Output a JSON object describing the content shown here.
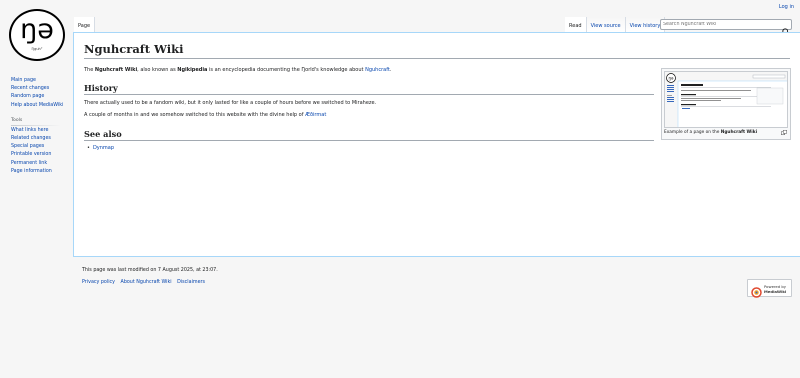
{
  "logo": {
    "glyph": "ŋə",
    "subtitle": "Ŋguh°"
  },
  "personal": {
    "login": "Log in"
  },
  "sidebar": {
    "navigation": [
      {
        "label": "Main page"
      },
      {
        "label": "Recent changes"
      },
      {
        "label": "Random page"
      },
      {
        "label": "Help about MediaWiki"
      }
    ],
    "tools_heading": "Tools",
    "tools": [
      {
        "label": "What links here"
      },
      {
        "label": "Related changes"
      },
      {
        "label": "Special pages"
      },
      {
        "label": "Printable version"
      },
      {
        "label": "Permanent link"
      },
      {
        "label": "Page information"
      }
    ]
  },
  "tabs": {
    "left": [
      {
        "label": "Page"
      }
    ],
    "right": [
      {
        "label": "Read"
      },
      {
        "label": "View source"
      },
      {
        "label": "View history"
      }
    ]
  },
  "search": {
    "placeholder": "Search Nguhcraft Wiki"
  },
  "article": {
    "title": "Nguhcraft Wiki",
    "intro": {
      "t1": "The ",
      "b1": "Nguhcraft Wiki",
      "t2": ", also known as ",
      "b2": "Ngikipedia",
      "t3": " is an encyclopedia documenting the Ŋorld's knowledge about ",
      "link": "Nguhcraft",
      "t4": "."
    },
    "history_heading": "History",
    "history_p1": "There actually used to be a fandom wiki, but it only lasted for like a couple of hours before we switched to Miraheze.",
    "history_p2": {
      "text": "A couple of months in and we somehow switched to this website with the divine help of ",
      "link": "Æðirmat"
    },
    "seealso_heading": "See also",
    "seealso": [
      {
        "label": "Dynmap"
      }
    ]
  },
  "thumbnail": {
    "caption_prefix": "Example of a page on the ",
    "caption_bold": "Nguhcraft Wiki"
  },
  "footer": {
    "last_modified": "This page was last modified on 7 August 2025, at 23:07.",
    "links": [
      {
        "label": "Privacy policy"
      },
      {
        "label": "About Nguhcraft Wiki"
      },
      {
        "label": "Disclaimers"
      }
    ],
    "powered_line1": "Powered by",
    "powered_line2": "MediaWiki"
  },
  "colors": {
    "link": "#0645ad",
    "border": "#a7d7f9",
    "text": "#202122"
  },
  "icons": {
    "search": "search-icon",
    "magnify": "magnify-icon",
    "mediawiki": "mediawiki-logo-icon"
  }
}
